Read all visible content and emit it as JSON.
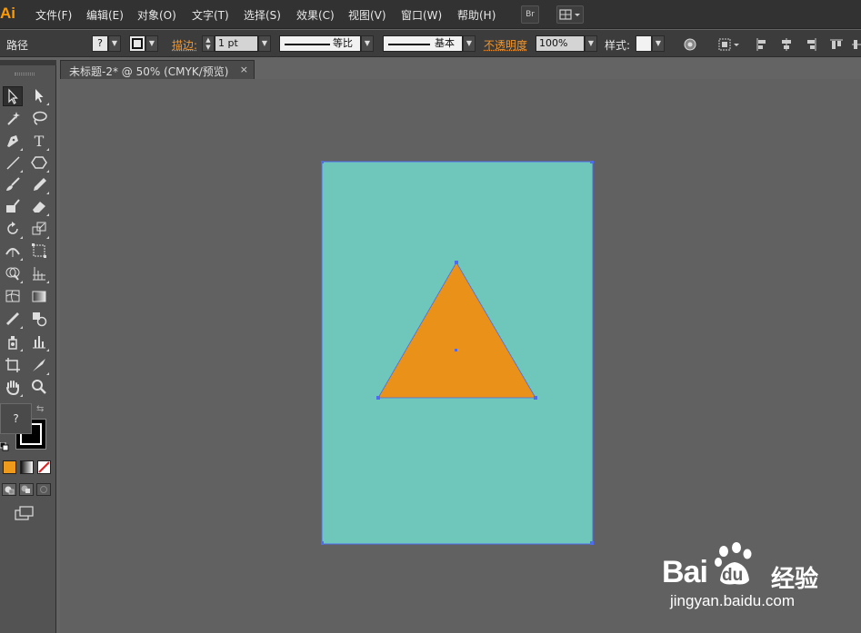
{
  "app": {
    "logo": "Ai"
  },
  "menu": [
    {
      "label": "文件(F)",
      "name": "menu-file"
    },
    {
      "label": "编辑(E)",
      "name": "menu-edit"
    },
    {
      "label": "对象(O)",
      "name": "menu-object"
    },
    {
      "label": "文字(T)",
      "name": "menu-type"
    },
    {
      "label": "选择(S)",
      "name": "menu-select"
    },
    {
      "label": "效果(C)",
      "name": "menu-effect"
    },
    {
      "label": "视图(V)",
      "name": "menu-view"
    },
    {
      "label": "窗口(W)",
      "name": "menu-window"
    },
    {
      "label": "帮助(H)",
      "name": "menu-help"
    }
  ],
  "menu_buttons": {
    "bridge": "Br",
    "arrange_icon": "arrange-documents-icon"
  },
  "controlbar": {
    "selection_label": "路径",
    "fill_value": "?",
    "stroke_label": "描边:",
    "stroke_weight": "1 pt",
    "profile_label": "等比",
    "brush_label": "基本",
    "opacity_label": "不透明度",
    "opacity_value": "100%",
    "style_label": "样式:"
  },
  "document_tab": {
    "title": "未标题-2* @ 50% (CMYK/预览)",
    "close": "×"
  },
  "toolpanel": {
    "fill_unknown": "?"
  },
  "colors": {
    "artboard_fill": "#6fc6bb",
    "triangle_fill": "#e99118",
    "selection": "#4f6cf0",
    "canvas_bg": "#616161",
    "panel_bg": "#535353",
    "accent_orange": "#ff9a00"
  },
  "watermark": {
    "main": "Bai",
    "paw": "du",
    "sub": "经验",
    "url": "jingyan.baidu.com"
  }
}
